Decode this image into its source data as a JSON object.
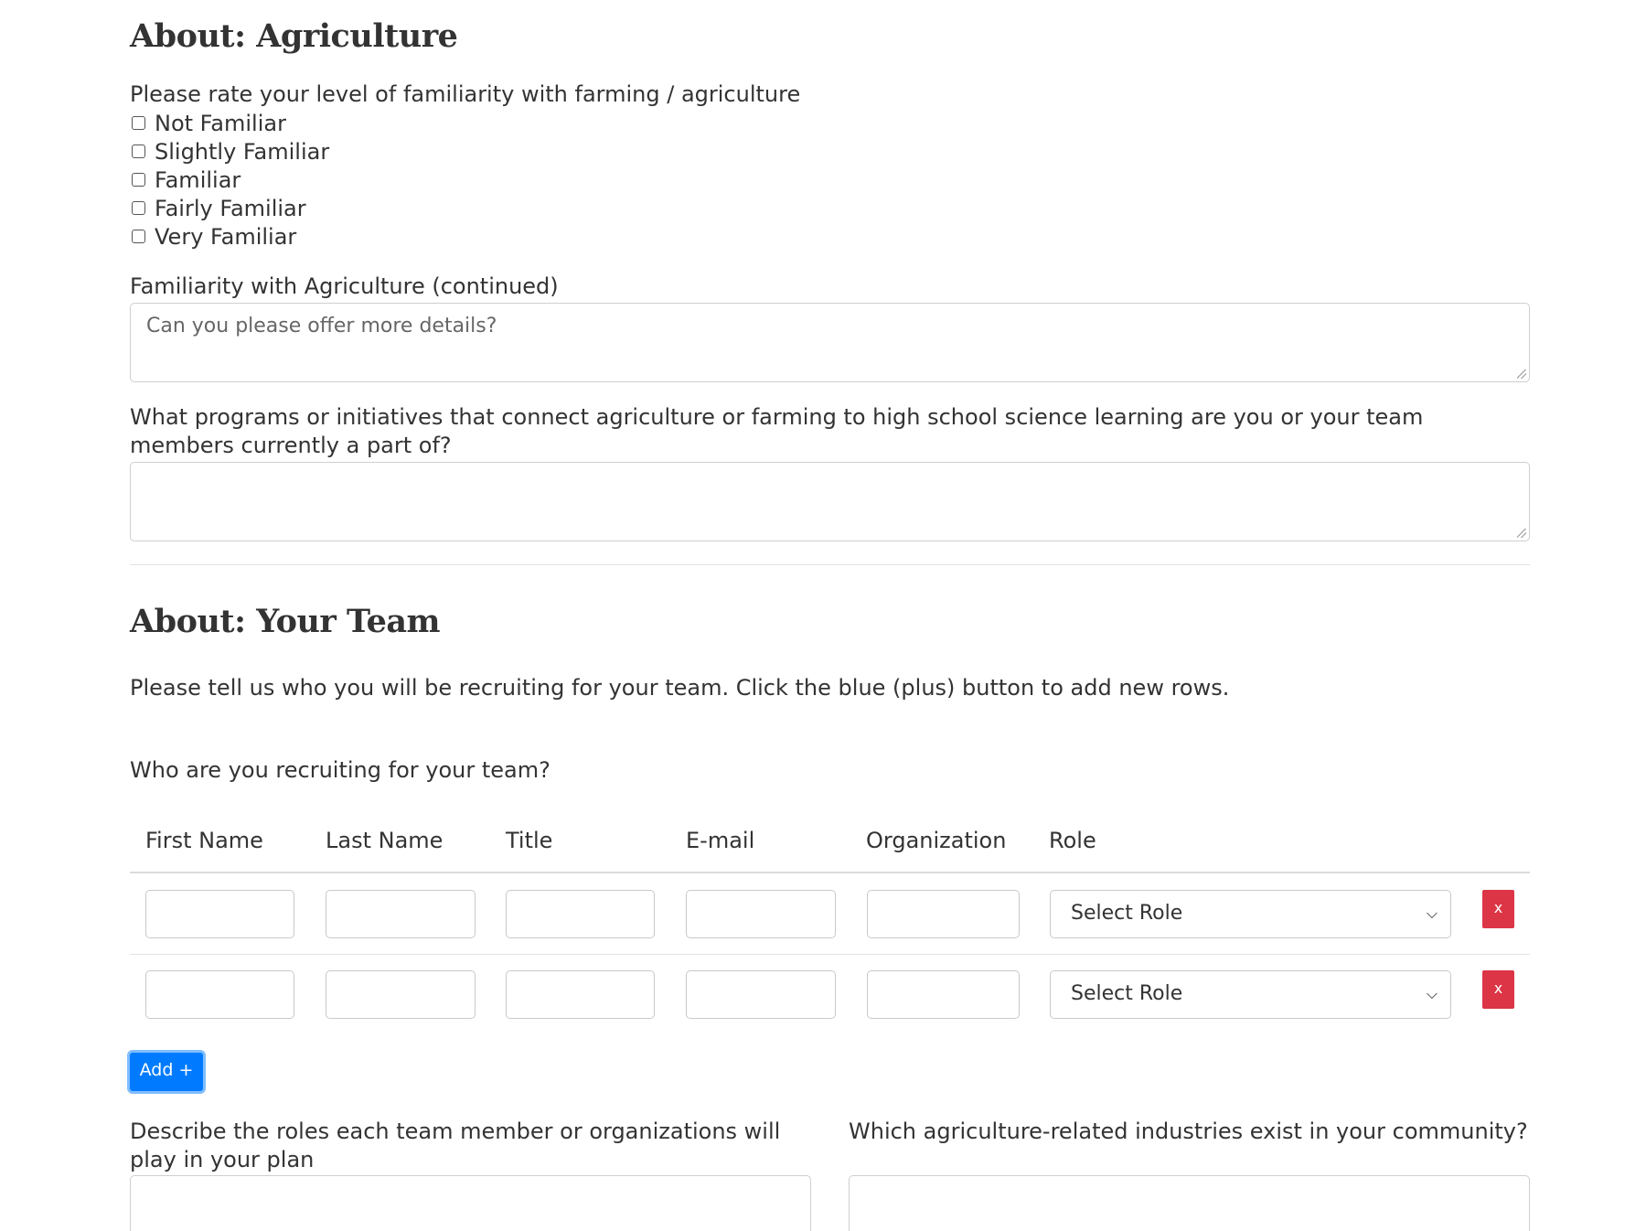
{
  "agriculture": {
    "heading": "About: Agriculture",
    "familiarity_question": "Please rate your level of familiarity with farming / agriculture",
    "options": [
      "Not Familiar",
      "Slightly Familiar",
      "Familiar",
      "Fairly Familiar",
      "Very Familiar"
    ],
    "continued_label": "Familiarity with Agriculture (continued)",
    "continued_placeholder": "Can you please offer more details?",
    "programs_label": "What programs or initiatives that connect agriculture or farming to high school science learning are you or your team members currently a part of?",
    "programs_value": ""
  },
  "team": {
    "heading": "About: Your Team",
    "intro": "Please tell us who you will be recruiting for your team. Click the blue (plus) button to add new rows.",
    "recruit_question": "Who are you recruiting for your team?",
    "columns": [
      "First Name",
      "Last Name",
      "Title",
      "E-mail",
      "Organization",
      "Role"
    ],
    "rows": [
      {
        "first_name": "",
        "last_name": "",
        "title": "",
        "email": "",
        "organization": "",
        "role": "Select Role",
        "remove": "x"
      },
      {
        "first_name": "",
        "last_name": "",
        "title": "",
        "email": "",
        "organization": "",
        "role": "Select Role",
        "remove": "x"
      }
    ],
    "add_button": "Add +",
    "roles_label": "Describe the roles each team member or organizations will play in your plan",
    "industries_label": "Which agriculture-related industries exist in your community?"
  },
  "colors": {
    "primary": "#007bff",
    "danger": "#dc3545",
    "text": "#333333",
    "border": "#cfcfcf"
  }
}
